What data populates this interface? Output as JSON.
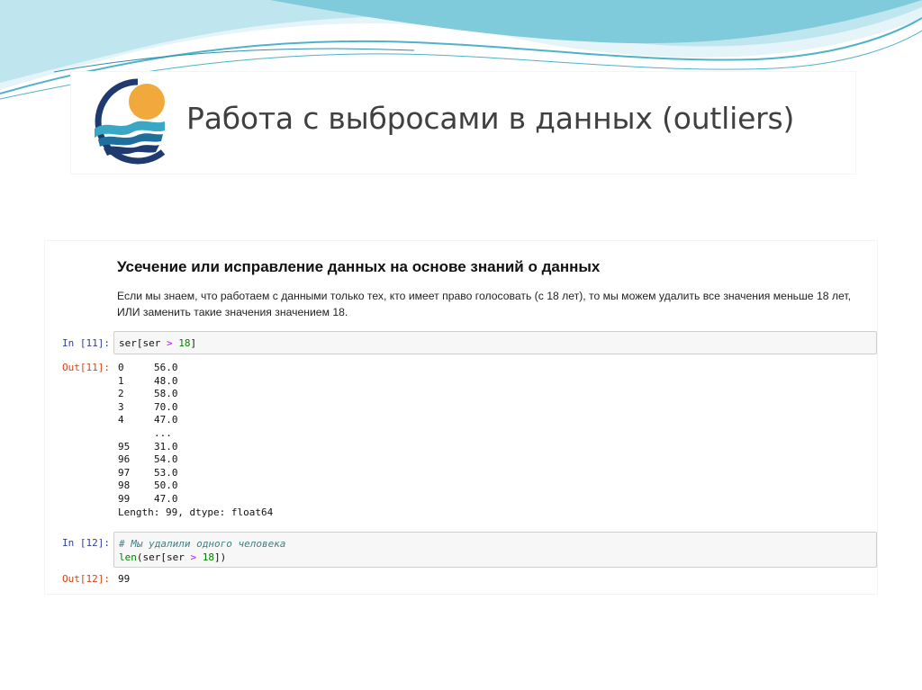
{
  "slide": {
    "title": "Работа с выбросами в данных (outliers)"
  },
  "notebook": {
    "heading": "Усечение или исправление данных на основе знаний о данных",
    "paragraph": "Если мы знаем, что работаем с данными только тех, кто имеет право голосовать (с 18 лет), то мы можем удалить все значения меньше 18 лет, ИЛИ заменить такие значения значением 18.",
    "cells": [
      {
        "in_prompt": "In [11]:",
        "code": {
          "part1": "ser[ser ",
          "op": ">",
          "part2": " ",
          "num": "18",
          "part3": "]"
        },
        "out_prompt": "Out[11]:",
        "rows": [
          {
            "idx": "0",
            "val": "56.0"
          },
          {
            "idx": "1",
            "val": "48.0"
          },
          {
            "idx": "2",
            "val": "58.0"
          },
          {
            "idx": "3",
            "val": "70.0"
          },
          {
            "idx": "4",
            "val": "47.0"
          },
          {
            "idx": "",
            "val": "..."
          },
          {
            "idx": "95",
            "val": "31.0"
          },
          {
            "idx": "96",
            "val": "54.0"
          },
          {
            "idx": "97",
            "val": "53.0"
          },
          {
            "idx": "98",
            "val": "50.0"
          },
          {
            "idx": "99",
            "val": "47.0"
          }
        ],
        "footer": "Length: 99, dtype: float64"
      },
      {
        "in_prompt": "In [12]:",
        "comment": "# Мы удалили одного человека",
        "code": {
          "builtin": "len",
          "part1": "(ser[ser ",
          "op": ">",
          "part2": " ",
          "num": "18",
          "part3": "])"
        },
        "out_prompt": "Out[12]:",
        "result": "99"
      }
    ]
  },
  "colors": {
    "in_prompt": "#303f9f",
    "out_prompt": "#d84315",
    "wave_light": "#bfe6ef",
    "wave_teal": "#4fb3c8",
    "logo_navy": "#1f3a6e",
    "logo_sun": "#f2a93b"
  },
  "icons": {
    "logo": "sun-over-waves-logo"
  }
}
